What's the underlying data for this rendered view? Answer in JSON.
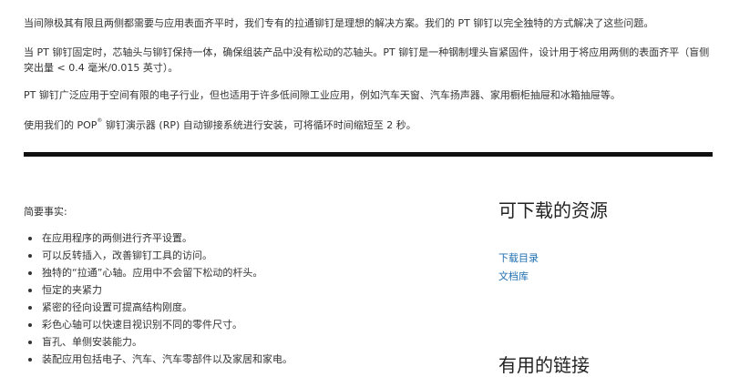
{
  "intro": {
    "p1": "当间隙极其有限且两侧都需要与应用表面齐平时，我们专有的拉通铆钉是理想的解决方案。我们的 PT 铆钉以完全独特的方式解决了这些问题。",
    "p2": "当 PT 铆钉固定时，芯轴头与铆钉保持一体，确保组装产品中没有松动的芯轴头。PT 铆钉是一种钢制埋头盲紧固件，设计用于将应用两侧的表面齐平（盲侧突出量 < 0.4 毫米/0.015 英寸）。",
    "p3": "PT 铆钉广泛应用于空间有限的电子行业，但也适用于许多低间隙工业应用，例如汽车天窗、汽车扬声器、家用橱柜抽屉和冰箱抽屉等。",
    "p4_before": "使用我们的 POP",
    "p4_sup": "®",
    "p4_after": " 铆钉演示器 (RP) 自动铆接系统进行安装，可将循环时间缩短至 2 秒。"
  },
  "facts": {
    "title": "简要事实:",
    "items": [
      "在应用程序的两侧进行齐平设置。",
      "可以反转插入，改善铆钉工具的访问。",
      "独特的“拉通”心轴。应用中不会留下松动的杆头。",
      "恒定的夹紧力",
      "紧密的径向设置可提高结构刚度。",
      "彩色心轴可以快速目视识别不同的零件尺寸。",
      "盲孔、单侧安装能力。",
      "装配应用包括电子、汽车、汽车零部件以及家居和家电。"
    ]
  },
  "sidebar": {
    "resources_title": "可下载的资源",
    "links": [
      "下载目录",
      "文档库"
    ],
    "useful_links_title": "有用的链接"
  },
  "colors": {
    "link": "#1f6fb2",
    "rule": "#111111",
    "text": "#333333"
  }
}
